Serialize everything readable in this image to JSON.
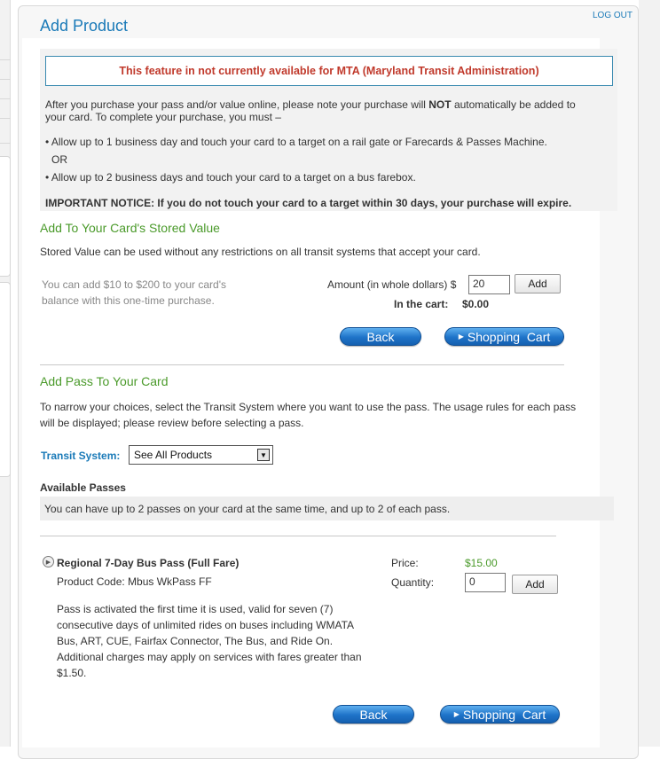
{
  "header": {
    "title": "Add Product",
    "logout": "LOG OUT"
  },
  "notice": {
    "alert": "This feature in not currently available for MTA (Maryland Transit Administration)",
    "intro_part1": "After you purchase your pass and/or value online, please note your purchase will ",
    "intro_bold": "NOT",
    "intro_part2": " automatically be added to",
    "intro_line2": "your card. To complete your purchase, you must –",
    "bullet1": "• Allow up to 1 business day and touch your card to a target on a rail gate or Farecards & Passes Machine.",
    "or": "OR",
    "bullet2": "• Allow up to 2 business days and touch your card to a target on a bus farebox.",
    "important": "IMPORTANT NOTICE: If you do not touch your card to a target within 30 days, your purchase will expire."
  },
  "stored_value": {
    "heading": "Add To Your Card's Stored Value",
    "description": "Stored Value can be used without any restrictions on all transit systems that accept your card.",
    "hint_line1": "You can add $10 to $200 to your card's",
    "hint_line2": "balance with this one-time purchase.",
    "amount_label": "Amount (in whole dollars) $",
    "amount_value": "20",
    "add_label": "Add",
    "cart_label": "In the cart:",
    "cart_value": "$0.00",
    "back_label": "Back",
    "shopping_cart_label": "Shopping  Cart"
  },
  "pass_section": {
    "heading": "Add Pass To Your Card",
    "description_line1": "To narrow your choices, select the Transit System where you want to use the pass. The usage rules for each pass",
    "description_line2": "will be displayed; please review before selecting a pass.",
    "transit_label": "Transit System:",
    "transit_selected": "See All Products",
    "available_heading": "Available Passes",
    "available_note": "You can have up to 2 passes on your card at the same time, and up to 2 of each pass."
  },
  "product": {
    "name": "Regional 7-Day Bus Pass (Full Fare)",
    "code": "Product Code: Mbus WkPass FF",
    "desc_lines": [
      "Pass is activated the first time it is used, valid for seven (7)",
      "consecutive days of unlimited rides on buses including WMATA",
      "Bus, ART, CUE, Fairfax Connector, The Bus, and Ride On.",
      "Additional charges may apply on services with fares greater than",
      "$1.50."
    ],
    "price_label": "Price:",
    "price_value": "$15.00",
    "quantity_label": "Quantity:",
    "quantity_value": "0",
    "add_label": "Add",
    "back_label": "Back",
    "shopping_cart_label": "Shopping  Cart"
  },
  "colors": {
    "accent_blue": "#1a7ab8",
    "heading_green": "#4a9a2a",
    "alert_red": "#c0392b"
  },
  "icons": {
    "expand": "circle-play-icon",
    "dropdown": "chevron-down-icon",
    "cart": "triangle-right-icon"
  }
}
